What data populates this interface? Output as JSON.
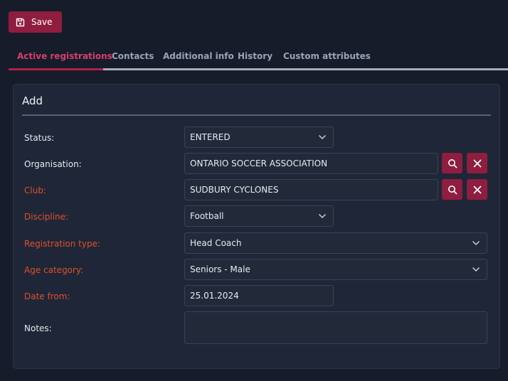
{
  "toolbar": {
    "save_label": "Save"
  },
  "tabs": [
    {
      "label": "Active registrations",
      "active": true
    },
    {
      "label": "Contacts",
      "active": false
    },
    {
      "label": "Additional info",
      "active": false
    },
    {
      "label": "History",
      "active": false
    },
    {
      "label": "Custom attributes",
      "active": false
    }
  ],
  "form": {
    "title": "Add",
    "status": {
      "label": "Status:",
      "value": "ENTERED"
    },
    "organisation": {
      "label": "Organisation:",
      "value": "ONTARIO SOCCER ASSOCIATION"
    },
    "club": {
      "label": "Club:",
      "value": "SUDBURY CYCLONES"
    },
    "discipline": {
      "label": "Discipline:",
      "value": "Football"
    },
    "registration_type": {
      "label": "Registration type:",
      "value": "Head Coach"
    },
    "age_category": {
      "label": "Age category:",
      "value": "Seniors - Male"
    },
    "date_from": {
      "label": "Date from:",
      "value": "25.01.2024"
    },
    "notes": {
      "label": "Notes:",
      "value": ""
    }
  },
  "colors": {
    "accent": "#8f1d3f",
    "active_tab": "#d63f6c",
    "required_label": "#e0512a",
    "background": "#161c29",
    "panel": "#1e2637"
  },
  "icons": {
    "save": "floppy-disk-icon",
    "search": "search-icon",
    "clear": "close-icon",
    "dropdown": "chevron-down-icon"
  }
}
